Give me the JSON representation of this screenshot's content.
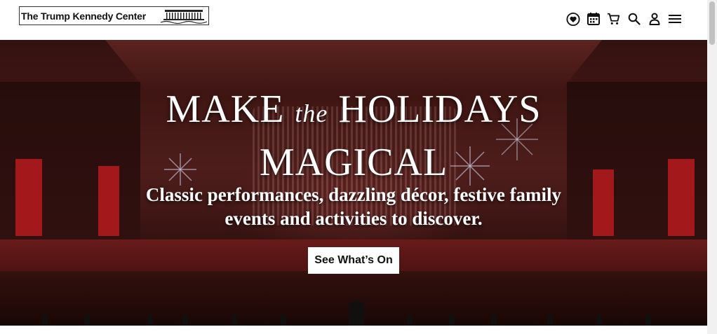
{
  "header": {
    "logo_text": "The Trump Kennedy Center",
    "icons": [
      "heart-icon",
      "calendar-icon",
      "cart-icon",
      "search-icon",
      "user-icon",
      "menu-icon"
    ]
  },
  "hero": {
    "title_line1_part1": "MAKE",
    "title_line1_part2": "the",
    "title_line1_part3": "HOLIDAYS",
    "title_line2": "MAGICAL",
    "subtitle_line1": "Classic performances, dazzling décor, festive family",
    "subtitle_line2": "events and activities to discover.",
    "cta_label": "See What’s On"
  },
  "colors": {
    "hero_red": "#c21d1f",
    "button_bg": "#ffffff",
    "text_light": "#ffffff"
  }
}
